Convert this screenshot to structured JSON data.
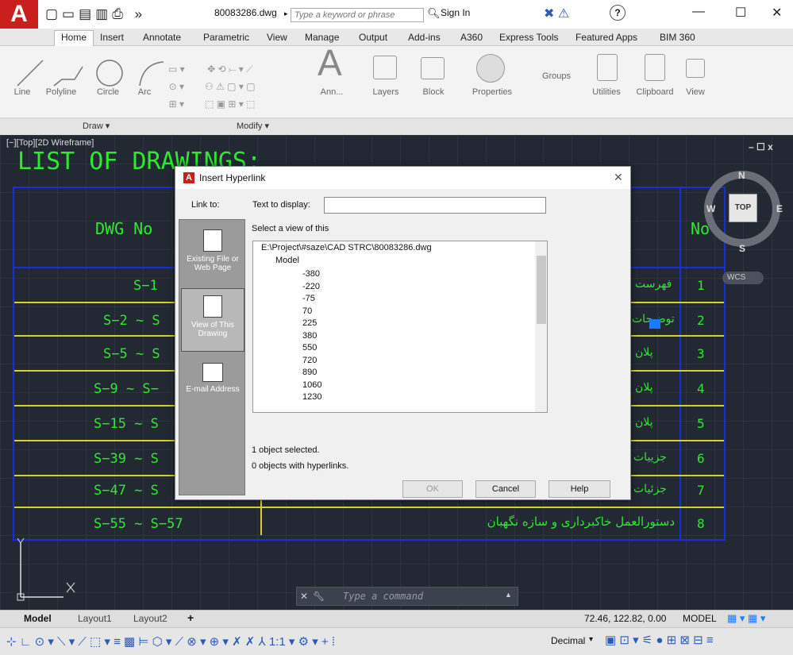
{
  "app": {
    "logo": "A",
    "quick_access": "▢▭▤▥⎙ »",
    "filename": "80083286.dwg",
    "search_placeholder": "Type a keyword or phrase",
    "sign_in": "Sign In",
    "help": "?",
    "min": "—",
    "max": "☐",
    "close": "✕"
  },
  "tabs": [
    "Home",
    "Insert",
    "Annotate",
    "Parametric",
    "View",
    "Manage",
    "Output",
    "Add-ins",
    "A360",
    "Express Tools",
    "Featured Apps",
    "BIM 360"
  ],
  "ribbon": {
    "draw_tools": [
      "Line",
      "Polyline",
      "Circle",
      "Arc"
    ],
    "draw_panel": "Draw ▾",
    "modify_panel": "Modify ▾",
    "big": [
      "Ann...",
      "Layers",
      "Block",
      "Properties",
      "Groups",
      "Utilities",
      "Clipboard",
      "View"
    ]
  },
  "viewport": {
    "label": "[−][Top][2D Wireframe]",
    "ctl": "–  ☐  x"
  },
  "drawing": {
    "title": "LIST OF DRAWINGS:",
    "col_dwg": "DWG No",
    "col_no": "No.",
    "rows": [
      {
        "dwg": "S−1",
        "fa": "فهرست",
        "no": "1"
      },
      {
        "dwg": "S−2  ~  S",
        "fa": "توضیحات",
        "no": "2"
      },
      {
        "dwg": "S−5  ~  S",
        "fa": "پلان",
        "no": "3"
      },
      {
        "dwg": "S−9  ~  S−",
        "fa": "پلان",
        "no": "4"
      },
      {
        "dwg": "S−15  ~  S",
        "fa": "پلان",
        "no": "5"
      },
      {
        "dwg": "S−39  ~  S",
        "fa": "جزییات",
        "no": "6"
      },
      {
        "dwg": "S−47  ~  S",
        "fa": "جزئیات",
        "no": "7"
      },
      {
        "dwg": "S−55  ~  S−57",
        "fa": "دستورالعمل خاکبرداری و سازه نگهبان",
        "no": "8"
      }
    ]
  },
  "compass": {
    "n": "N",
    "s": "S",
    "e": "E",
    "w": "W",
    "top": "TOP",
    "wcs": "WCS"
  },
  "dialog": {
    "title": "Insert Hyperlink",
    "close": "✕",
    "link_to": "Link to:",
    "text_display_label": "Text to display:",
    "text_display_value": "",
    "select_view": "Select a view of this",
    "tree_root": "E:\\Project\\#saze\\CAD STRC\\80083286.dwg",
    "tree_model": "Model",
    "views": [
      "-380",
      "-220",
      "-75",
      "70",
      "225",
      "380",
      "550",
      "720",
      "890",
      "1060",
      "1230"
    ],
    "nav": [
      {
        "label": "Existing File or Web Page"
      },
      {
        "label": "View of This Drawing"
      },
      {
        "label": "E-mail Address"
      }
    ],
    "status1": "1 object selected.",
    "status2": "0 objects with hyperlinks.",
    "ok": "OK",
    "cancel": "Cancel",
    "help": "Help"
  },
  "command": {
    "placeholder": "Type a command"
  },
  "status": {
    "model_tab": "Model",
    "layout1": "Layout1",
    "layout2": "Layout2",
    "coords": "72.46, 122.82, 0.00",
    "model": "MODEL",
    "units": "Decimal",
    "scale": "1:1"
  }
}
